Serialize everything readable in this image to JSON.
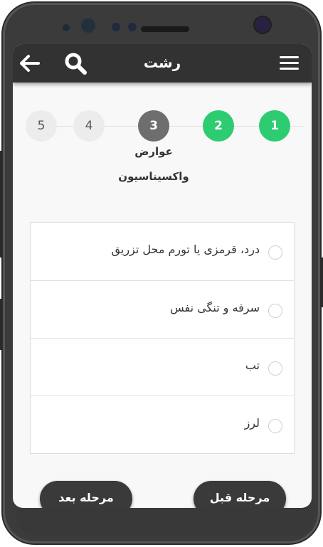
{
  "appbar": {
    "title": "رشت",
    "menu_icon": "hamburger-menu-icon",
    "search_icon": "search-icon",
    "back_icon": "arrow-left-icon",
    "background": "#323232"
  },
  "stepper": {
    "steps": [
      {
        "label": "1",
        "state": "done"
      },
      {
        "label": "2",
        "state": "done"
      },
      {
        "label": "3",
        "state": "current"
      },
      {
        "label": "4",
        "state": "todo"
      },
      {
        "label": "5",
        "state": "todo"
      }
    ],
    "current_caption_line1": "عوارض",
    "current_caption_line2": "واکسیناسیون",
    "done_color": "#2ecc71",
    "current_color": "#6e6e6e"
  },
  "options": [
    {
      "label": "درد، قرمزی یا تورم محل تزریق",
      "checked": false
    },
    {
      "label": "سرفه و تنگی نفس",
      "checked": false
    },
    {
      "label": "تب",
      "checked": false
    },
    {
      "label": "لرز",
      "checked": false
    }
  ],
  "footer": {
    "next_label": "مرحله بعد",
    "prev_label": "مرحله قبل"
  }
}
